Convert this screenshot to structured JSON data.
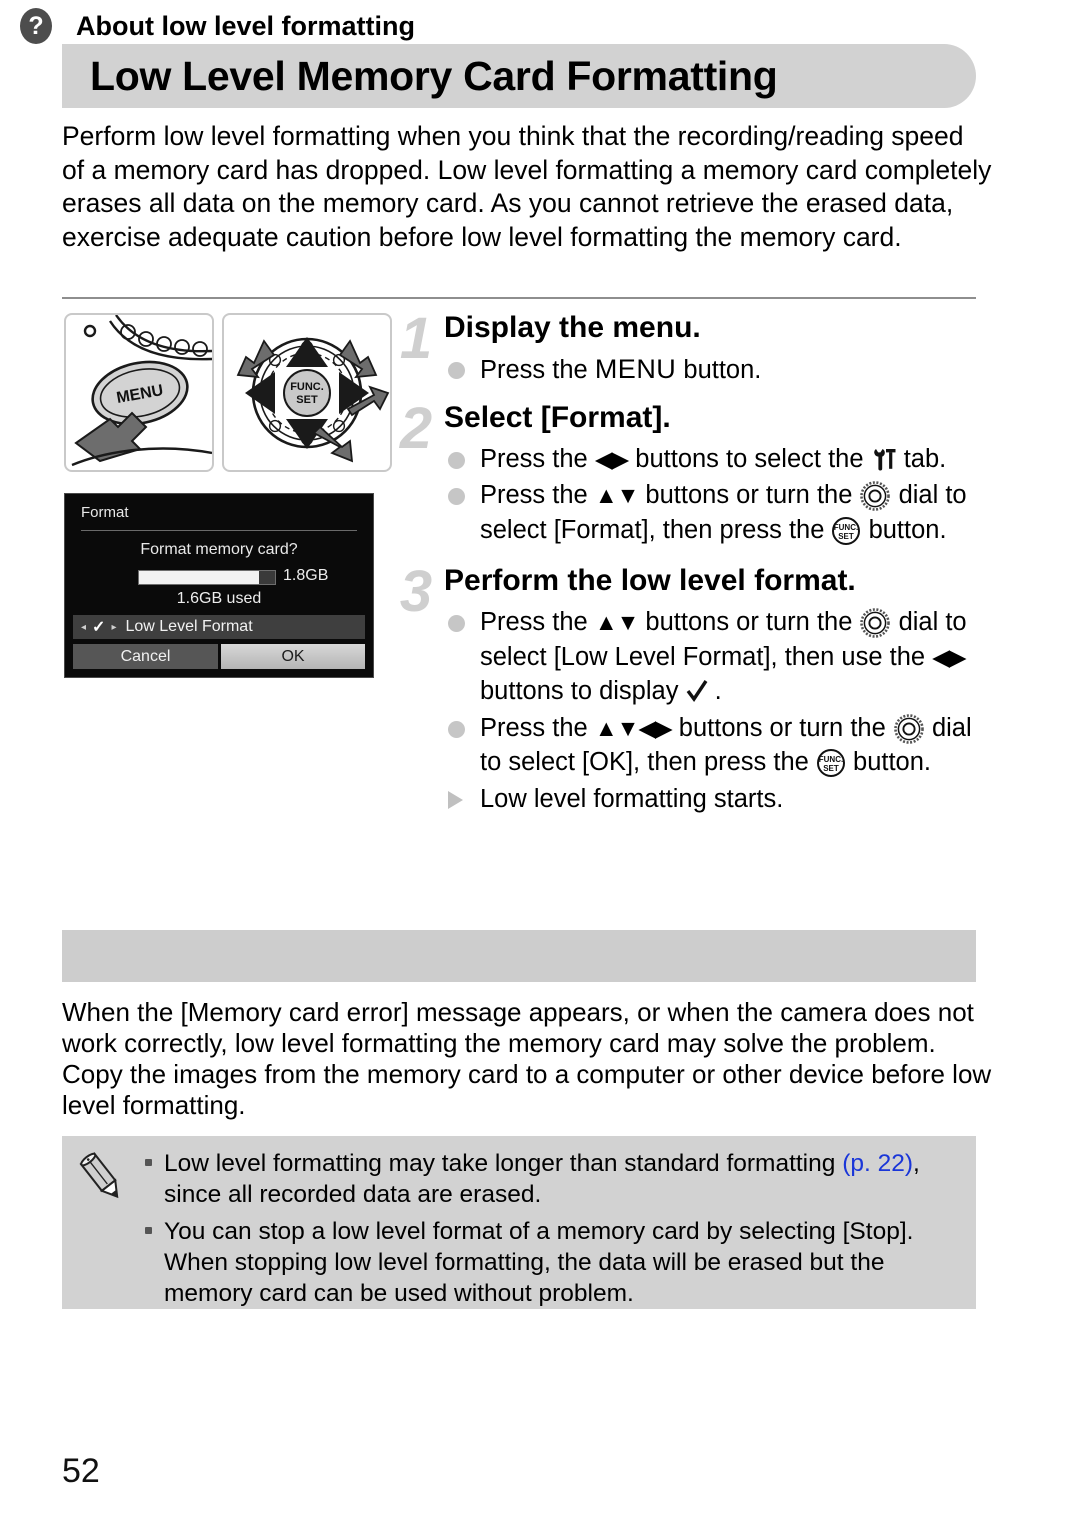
{
  "page": {
    "title": "Low Level Memory Card Formatting",
    "number": "52",
    "intro": "Perform low level formatting when you think that the recording/reading speed of a memory card has dropped. Low level formatting a memory card completely erases all data on the memory card. As you cannot retrieve the erased data, exercise adequate caution before low level formatting the memory card."
  },
  "illustrations": {
    "menu_button_label": "MENU",
    "dial_button_line1": "FUNC.",
    "dial_button_line2": "SET"
  },
  "lcd": {
    "title": "Format",
    "question": "Format memory card?",
    "capacity": "1.8GB",
    "used": "1.6GB used",
    "bar_fill_percent": 88,
    "low_level_label": "Low Level Format",
    "low_level_checked": true,
    "left_arrow": "◂",
    "right_arrow": "▸",
    "check_mark": "✓",
    "cancel_label": "Cancel",
    "ok_label": "OK",
    "selected_button": "OK"
  },
  "steps": [
    {
      "number": "1",
      "heading": "Display the menu.",
      "bullets": [
        {
          "marker": "dot",
          "pre": "Press the ",
          "icon": "menu-word",
          "post": " button."
        }
      ]
    },
    {
      "number": "2",
      "heading": "Select [Format].",
      "bullets": [
        {
          "marker": "dot",
          "text_a": "Press the ",
          "icon_a": "left-right-arrows",
          "text_b": " buttons to select the ",
          "icon_b": "settings-tab-icon",
          "text_c": " tab."
        },
        {
          "marker": "dot",
          "text_a": "Press the ",
          "icon_a": "up-down-arrows",
          "text_b": " buttons or turn the ",
          "icon_b": "control-dial-icon",
          "text_c": " dial to select [Format], then press the ",
          "icon_c": "func-set-icon",
          "text_d": " button."
        }
      ]
    },
    {
      "number": "3",
      "heading": "Perform the low level format.",
      "bullets": [
        {
          "marker": "dot",
          "text_a": "Press the ",
          "icon_a": "up-down-arrows",
          "text_b": " buttons or turn the ",
          "icon_b": "control-dial-icon",
          "text_c": " dial to select [Low Level Format], then use the ",
          "icon_c": "left-right-arrows",
          "text_d": " buttons to display ",
          "icon_d": "check-mark-icon",
          "text_e": " ."
        },
        {
          "marker": "dot",
          "text_a": "Press the ",
          "icon_a": "up-down-left-right-arrows",
          "text_b": " buttons or turn the ",
          "icon_b": "control-dial-icon",
          "text_c": " dial to select [OK], then press the ",
          "icon_c": "func-set-icon",
          "text_d": " button."
        },
        {
          "marker": "triangle",
          "text_a": "Low level formatting starts."
        }
      ]
    }
  ],
  "about": {
    "icon": "question-mark-icon",
    "title": "About low level formatting",
    "body": "When the [Memory card error] message appears, or when the camera does not work correctly, low level formatting the memory card may solve the problem. Copy the images from the memory card to a computer or other device before low level formatting."
  },
  "note": {
    "icon": "pencil-icon",
    "items": [
      {
        "pre": "Low level formatting may take longer than standard formatting ",
        "link": "(p. 22)",
        "post": ", since all recorded data are erased."
      },
      {
        "pre": "You can stop a low level format of a memory card by selecting [Stop]. When stopping low level formatting, the data will be erased but the memory card can be used without problem.",
        "link": "",
        "post": ""
      }
    ]
  },
  "colors": {
    "band_gray": "#cdcdcd",
    "title_gray": "#d2d2d2",
    "note_gray": "#d2d2d2",
    "step_number_gray": "#cfcfcf",
    "link_blue": "#1a36d8",
    "lcd_background": "#0a0a0a"
  }
}
